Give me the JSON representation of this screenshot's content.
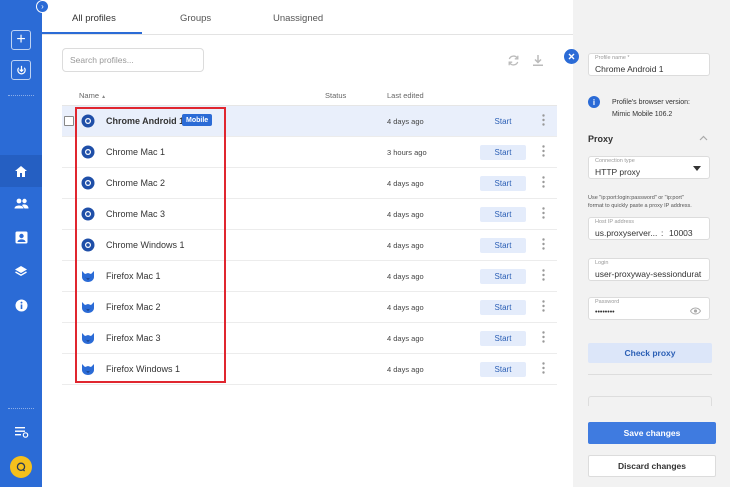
{
  "tabs": [
    {
      "label": "All profiles",
      "active": true
    },
    {
      "label": "Groups",
      "active": false
    },
    {
      "label": "Unassigned",
      "active": false
    }
  ],
  "search": {
    "placeholder": "Search profiles..."
  },
  "table": {
    "headers": {
      "name": "Name",
      "status": "Status",
      "last_edited": "Last edited"
    },
    "sort_indicator": "▲",
    "rows": [
      {
        "name": "Chrome Android 1",
        "browser": "chrome",
        "badge": "Mobile",
        "last_edited": "4 days ago",
        "action": "Start",
        "selected": true
      },
      {
        "name": "Chrome Mac 1",
        "browser": "chrome",
        "last_edited": "3 hours ago",
        "action": "Start"
      },
      {
        "name": "Chrome Mac 2",
        "browser": "chrome",
        "last_edited": "4 days ago",
        "action": "Start"
      },
      {
        "name": "Chrome Mac 3",
        "browser": "chrome",
        "last_edited": "4 days ago",
        "action": "Start"
      },
      {
        "name": "Chrome Windows 1",
        "browser": "chrome",
        "last_edited": "4 days ago",
        "action": "Start"
      },
      {
        "name": "Firefox Mac 1",
        "browser": "firefox",
        "last_edited": "4 days ago",
        "action": "Start"
      },
      {
        "name": "Firefox Mac 2",
        "browser": "firefox",
        "last_edited": "4 days ago",
        "action": "Start"
      },
      {
        "name": "Firefox Mac 3",
        "browser": "firefox",
        "last_edited": "4 days ago",
        "action": "Start"
      },
      {
        "name": "Firefox Windows 1",
        "browser": "firefox",
        "last_edited": "4 days ago",
        "action": "Start"
      }
    ]
  },
  "panel": {
    "profile_name_label": "Profile name *",
    "profile_name_value": "Chrome Android 1",
    "browser_version_line1": "Profile's browser version:",
    "browser_version_line2": "Mimic Mobile 106.2",
    "proxy_title": "Proxy",
    "connection_type_label": "Connection type",
    "connection_type_value": "HTTP proxy",
    "hint_line1": "Use \"ip:port:login:password\" or \"ip:port\"",
    "hint_line2": "format to quickly paste a proxy IP address.",
    "host_label": "Host IP address",
    "host_value": "us.proxyserver...",
    "port_separator": ":",
    "port_value": "10003",
    "login_label": "Login",
    "login_value": "user-proxyway-sessiondurat",
    "password_label": "Password",
    "password_value": "••••••••",
    "check_proxy_label": "Check proxy",
    "save_label": "Save changes",
    "discard_label": "Discard changes"
  },
  "colors": {
    "sidebar": "#2b6bd6",
    "accent": "#2b6bd6",
    "highlight_box": "#e0262f",
    "selected_row": "#e9effb"
  },
  "icons": {
    "sidebar_top": [
      "plus-icon",
      "import-icon"
    ],
    "sidebar_nav": [
      "home-icon",
      "users-icon",
      "contact-card-icon",
      "layers-icon",
      "info-icon"
    ],
    "sidebar_bottom": [
      "list-settings-icon",
      "help-chat-icon"
    ],
    "toolbar": [
      "refresh-icon",
      "download-icon"
    ]
  }
}
